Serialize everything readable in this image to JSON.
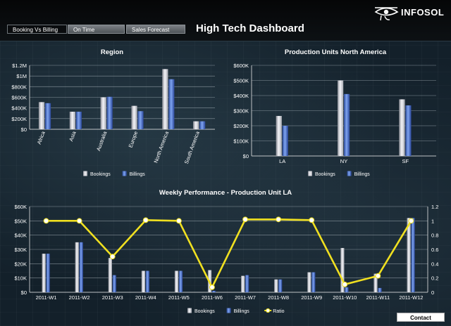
{
  "tabs": [
    {
      "label": "Booking Vs Billing",
      "active": true
    },
    {
      "label": "On Time",
      "active": false
    },
    {
      "label": "Sales Forecast",
      "active": false
    }
  ],
  "dashboard_title": "High Tech Dashboard",
  "logo_text": "INFOSOL",
  "contact_label": "Contact",
  "colors": {
    "bookings": "#d9d9e0",
    "billings": "#3b5fb8",
    "ratio": "#f0e020",
    "ratio_marker": "#ffffff"
  },
  "chart_data": [
    {
      "type": "bar",
      "title": "Region",
      "categories": [
        "Africa",
        "Asia",
        "Australia",
        "Europe",
        "North America",
        "South America"
      ],
      "series": [
        {
          "name": "Bookings",
          "values": [
            510000,
            330000,
            600000,
            440000,
            1130000,
            150000
          ]
        },
        {
          "name": "Billings",
          "values": [
            490000,
            330000,
            610000,
            340000,
            940000,
            150000
          ]
        }
      ],
      "y_ticks": [
        "$0",
        "$200K",
        "$400K",
        "$600K",
        "$800K",
        "$1M",
        "$1.2M"
      ],
      "ylim": [
        0,
        1200000
      ],
      "legend": "bottom"
    },
    {
      "type": "bar",
      "title": "Production Units North America",
      "categories": [
        "LA",
        "NY",
        "SF"
      ],
      "series": [
        {
          "name": "Bookings",
          "values": [
            265000,
            500000,
            375000
          ]
        },
        {
          "name": "Billings",
          "values": [
            200000,
            410000,
            335000
          ]
        }
      ],
      "y_ticks": [
        "$0",
        "$100K",
        "$200K",
        "$300K",
        "$400K",
        "$500K",
        "$600K"
      ],
      "ylim": [
        0,
        600000
      ],
      "legend": "bottom"
    },
    {
      "type": "bar",
      "title": "Weekly Performance - Production Unit LA",
      "categories": [
        "2011-W1",
        "2011-W2",
        "2011-W3",
        "2011-W4",
        "2011-W5",
        "2011-W6",
        "2011-W7",
        "2011-W8",
        "2011-W9",
        "2011-W10",
        "2011-W11",
        "2011-W12"
      ],
      "series": [
        {
          "name": "Bookings",
          "values": [
            27000,
            35000,
            24000,
            15000,
            15000,
            15500,
            11500,
            9000,
            14000,
            31000,
            13000,
            52000
          ]
        },
        {
          "name": "Billings",
          "values": [
            27000,
            35000,
            12000,
            15000,
            15000,
            1000,
            12000,
            9000,
            14000,
            3500,
            3000,
            52000
          ]
        },
        {
          "name": "Ratio",
          "values": [
            1.0,
            1.0,
            0.5,
            1.01,
            1.0,
            0.07,
            1.02,
            1.02,
            1.01,
            0.11,
            0.23,
            1.0
          ],
          "axis": "right"
        }
      ],
      "y_ticks": [
        "$0",
        "$10K",
        "$20K",
        "$30K",
        "$40K",
        "$50K",
        "$60K"
      ],
      "ylim": [
        0,
        60000
      ],
      "y2_ticks": [
        "0",
        "0.2",
        "0.4",
        "0.6",
        "0.8",
        "1",
        "1.2"
      ],
      "y2lim": [
        0,
        1.2
      ],
      "legend": "bottom"
    }
  ]
}
